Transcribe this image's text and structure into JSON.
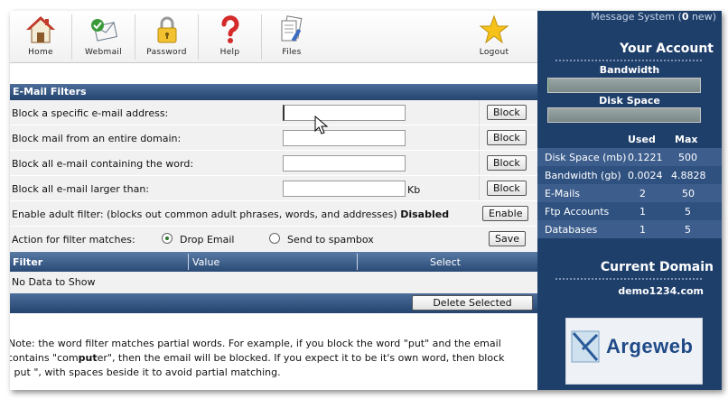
{
  "toolbar": {
    "items": [
      {
        "label": "Home",
        "icon": "house-icon"
      },
      {
        "label": "Webmail",
        "icon": "webmail-icon"
      },
      {
        "label": "Password",
        "icon": "padlock-icon"
      },
      {
        "label": "Help",
        "icon": "question-icon"
      },
      {
        "label": "Files",
        "icon": "files-icon"
      },
      {
        "label": "Logout",
        "icon": "star-icon"
      }
    ]
  },
  "filters": {
    "title": "E-Mail Filters",
    "rows": [
      {
        "label": "Block a specific e-mail address:",
        "value": "",
        "button": "Block"
      },
      {
        "label": "Block mail from an entire domain:",
        "value": "",
        "button": "Block"
      },
      {
        "label": "Block all e-mail containing the word:",
        "value": "",
        "button": "Block"
      },
      {
        "label": "Block all e-mail larger than:",
        "value": "",
        "unit": "Kb",
        "button": "Block"
      }
    ],
    "adult": {
      "label": "Enable adult filter: (blocks out common adult phrases, words, and addresses)",
      "status": "Disabled",
      "button": "Enable"
    },
    "action": {
      "label": "Action for filter matches:",
      "option_drop": "Drop Email",
      "option_spam": "Send to spambox",
      "selected": "Drop Email",
      "button": "Save"
    },
    "table": {
      "col_filter": "Filter",
      "col_value": "Value",
      "col_select": "Select",
      "empty": "No Data to Show",
      "delete_button": "Delete Selected"
    },
    "note_line1": "Note: the word filter matches partial words. For example, if you block the word \"put\" and the email",
    "note_line2_a": "contains \"com",
    "note_line2_b": "put",
    "note_line2_c": "er\", then the email will be blocked. If you expect it to be it's own word, then block",
    "note_line3": "\" put \", with spaces beside it to avoid partial matching."
  },
  "sidebar": {
    "msg_label": "Message System (",
    "msg_count": "0",
    "msg_suffix": " new)",
    "account_title": "Your Account",
    "bandwidth_label": "Bandwidth",
    "bandwidth_fraction": 0.0005,
    "disk_label": "Disk Space",
    "disk_fraction": 0.0002,
    "stats_header": {
      "used": "Used",
      "max": "Max"
    },
    "stats": [
      {
        "name": "Disk Space (mb)",
        "used": "0.1221",
        "max": "500"
      },
      {
        "name": "Bandwidth (gb)",
        "used": "0.0024",
        "max": "4.8828"
      },
      {
        "name": "E-Mails",
        "used": "2",
        "max": "50"
      },
      {
        "name": "Ftp Accounts",
        "used": "1",
        "max": "5"
      },
      {
        "name": "Databases",
        "used": "1",
        "max": "5"
      }
    ],
    "domain_title": "Current Domain",
    "domain": "demo1234.com",
    "logo_text": "Argeweb"
  },
  "colors": {
    "header_blue": "#24446f",
    "sidebar_blue": "#1f3f6b",
    "row_bg": "#f1f1f1"
  }
}
